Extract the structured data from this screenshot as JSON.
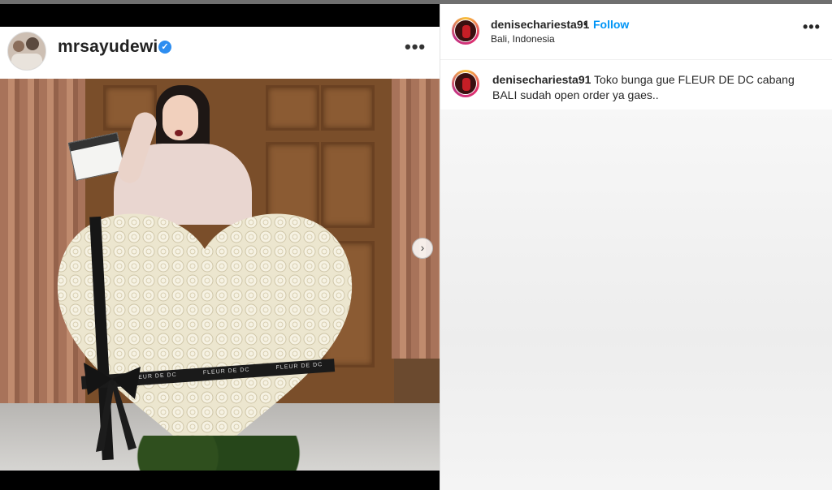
{
  "left_post": {
    "username": "mrsayudewi",
    "verified_icon": "verified-badge-icon",
    "more_icon": "more-options-icon",
    "more_label": "•••",
    "next_icon": "chevron-right-icon",
    "next_label": "›",
    "ribbon_text": "FLEUR DE DC"
  },
  "right_post": {
    "username": "denisechariesta91",
    "separator": "•",
    "follow_label": "Follow",
    "location": "Bali, Indonesia",
    "more_label": "•••",
    "caption_username": "denisechariesta91",
    "caption_text": "Toko bunga gue FLEUR DE DC cabang BALI sudah open order ya gaes.."
  },
  "colors": {
    "follow": "#0095f6",
    "verified": "#2d8df0",
    "text": "#262626"
  }
}
